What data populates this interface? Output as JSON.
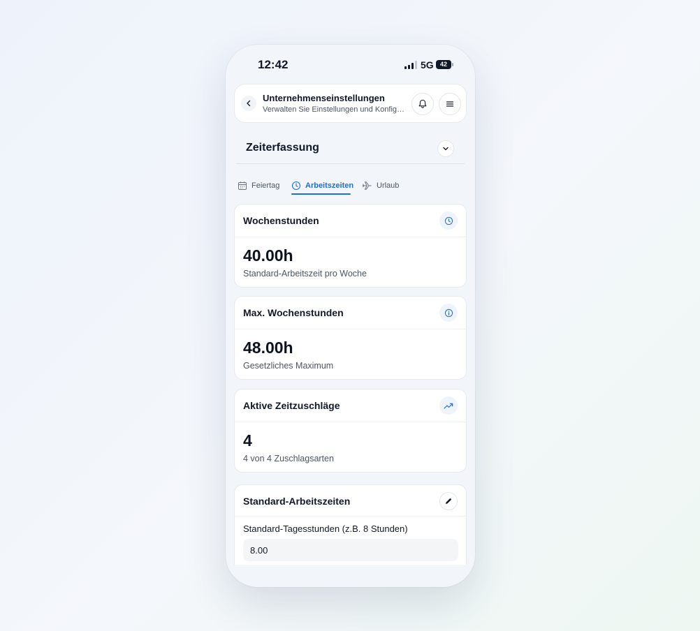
{
  "status": {
    "time": "12:42",
    "network": "5G",
    "battery": "42"
  },
  "header": {
    "title": "Unternehmenseinstellungen",
    "subtitle": "Verwalten Sie Einstellungen und Konfigurationen"
  },
  "section": {
    "title": "Zeiterfassung"
  },
  "tabs": [
    {
      "label": "Feiertag",
      "icon": "calendar-icon",
      "active": false
    },
    {
      "label": "Arbeitszeiten",
      "icon": "clock-icon",
      "active": true
    },
    {
      "label": "Urlaub",
      "icon": "plane-icon",
      "active": false
    }
  ],
  "cards": [
    {
      "title": "Wochenstunden",
      "value": "40.00h",
      "description": "Standard-Arbeitszeit pro Woche",
      "icon": "clock-icon"
    },
    {
      "title": "Max. Wochenstunden",
      "value": "48.00h",
      "description": "Gesetzliches Maximum",
      "icon": "info-icon"
    },
    {
      "title": "Aktive Zeitzuschläge",
      "value": "4",
      "description": "4 von 4 Zuschlagsarten",
      "icon": "trending-up-icon"
    }
  ],
  "standard": {
    "title": "Standard-Arbeitszeiten",
    "field_label": "Standard-Tagesstunden (z.B. 8 Stunden)",
    "field_value": "8.00"
  },
  "colors": {
    "accent": "#1d6ed8",
    "background": "#f2f5f9"
  }
}
